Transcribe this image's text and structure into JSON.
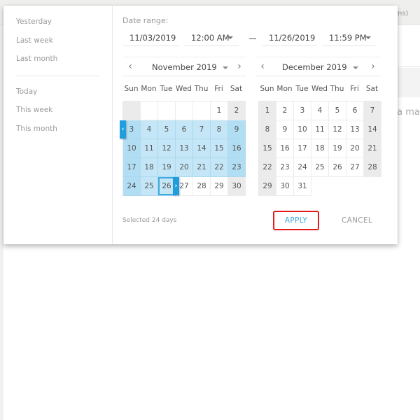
{
  "background": {
    "header_text": "ns)",
    "nodata_text": "ta ma"
  },
  "presets": {
    "group1": [
      "Yesterday",
      "Last week",
      "Last month"
    ],
    "group2": [
      "Today",
      "This week",
      "This month"
    ]
  },
  "range": {
    "label": "Date range:",
    "start_date": "11/03/2019",
    "start_time": "12:00 AM",
    "end_date": "11/26/2019",
    "end_time": "11:59 PM"
  },
  "weekdays": [
    "Sun",
    "Mon",
    "Tue",
    "Wed",
    "Thu",
    "Fri",
    "Sat"
  ],
  "calendars": [
    {
      "title": "November 2019",
      "prev_icon": "‹",
      "next_icon": "›",
      "leading_blanks": 5,
      "days": 30,
      "range_start": 3,
      "range_end": 26
    },
    {
      "title": "December 2019",
      "prev_icon": "‹",
      "next_icon": "›",
      "leading_blanks": 0,
      "days": 31,
      "range_start": null,
      "range_end": null
    }
  ],
  "handles": {
    "left": "‹",
    "right": "›"
  },
  "footer": {
    "selected_text": "Selected 24 days",
    "apply_label": "APPLY",
    "cancel_label": "CANCEL"
  },
  "colors": {
    "accent": "#3fa9e0",
    "range_fill": "#c4e6f6",
    "handle": "#1f9ddc",
    "highlight_border": "#e01b1b"
  }
}
